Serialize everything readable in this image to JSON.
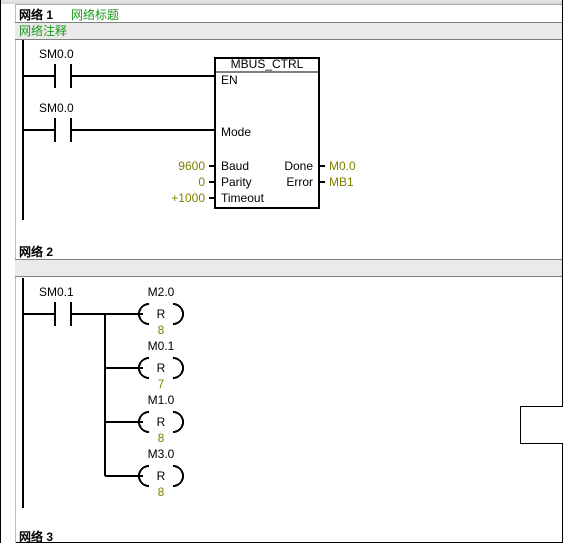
{
  "network1": {
    "label": "网络 1",
    "title": "网络标题",
    "comment": "网络注释",
    "contact1": "SM0.0",
    "contact2": "SM0.0",
    "block": {
      "name": "MBUS_CTRL",
      "pins_left": {
        "en": "EN",
        "mode": "Mode",
        "baud": "Baud",
        "parity": "Parity",
        "timeout": "Timeout"
      },
      "vals_left": {
        "baud": "9600",
        "parity": "0",
        "timeout": "+1000"
      },
      "pins_right": {
        "done": "Done",
        "error": "Error"
      },
      "vals_right": {
        "done": "M0.0",
        "error": "MB1"
      }
    }
  },
  "network2": {
    "label": "网络 2",
    "contact": "SM0.1",
    "coils": [
      {
        "addr": "M2.0",
        "op": "R",
        "n": "8"
      },
      {
        "addr": "M0.1",
        "op": "R",
        "n": "7"
      },
      {
        "addr": "M1.0",
        "op": "R",
        "n": "8"
      },
      {
        "addr": "M3.0",
        "op": "R",
        "n": "8"
      }
    ]
  },
  "network3": {
    "label": "网络 3"
  }
}
